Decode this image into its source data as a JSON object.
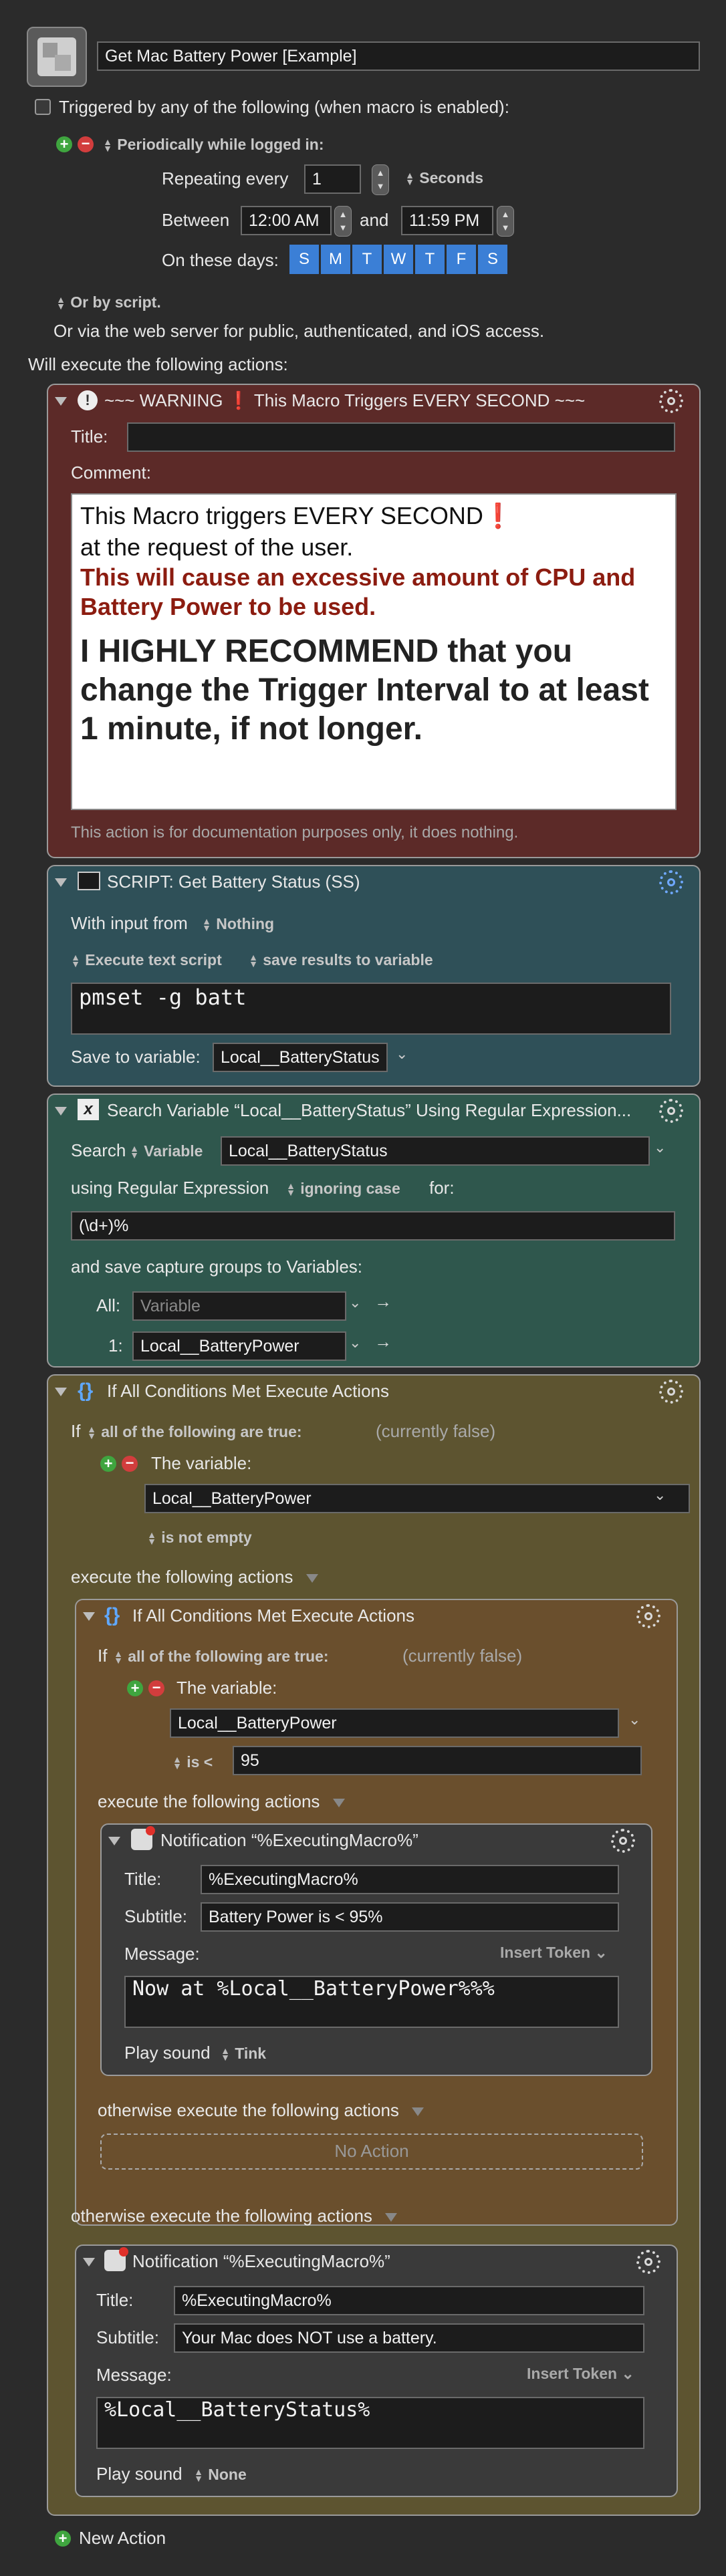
{
  "macro": {
    "name": "Get Mac Battery Power [Example]",
    "triggered_label": "Triggered by any of the following (when macro is enabled):",
    "trigger_type": "Periodically while logged in:",
    "repeating_label": "Repeating every",
    "repeating_value": "1",
    "repeating_unit": "Seconds",
    "between_label": "Between",
    "start_time": "12:00 AM",
    "and_label": "and",
    "end_time": "11:59 PM",
    "days_label": "On these days:",
    "days": [
      "S",
      "M",
      "T",
      "W",
      "T",
      "F",
      "S"
    ],
    "or_by_script": "Or by script.",
    "web_server": "Or via the web server for public, authenticated, and iOS access.",
    "will_execute": "Will execute the following actions:",
    "new_action": "New Action"
  },
  "warning": {
    "title": "~~~ WARNING",
    "title_tail": "This Macro Triggers EVERY SECOND ~~~",
    "title_label": "Title:",
    "title_value": "",
    "comment_label": "Comment:",
    "line1": "This Macro triggers EVERY SECOND",
    "line2": "at the request of the user.",
    "line3": "This will cause an excessive amount of CPU and Battery Power to be used.",
    "line4": "I HIGHLY RECOMMEND that you change the Trigger Interval to at least 1 minute, if not longer.",
    "footer": "This action is for documentation purposes only, it does nothing."
  },
  "script": {
    "title": "SCRIPT: Get Battery Status (SS)",
    "with_input": "With input from",
    "input_value": "Nothing",
    "execute_text": "Execute text script",
    "save_results": "save results to variable",
    "code": "pmset -g batt",
    "save_label": "Save to variable:",
    "save_value": "Local__BatteryStatus"
  },
  "regex": {
    "title": "Search Variable “Local__BatteryStatus” Using Regular Expression...",
    "search_label": "Search",
    "search_type": "Variable",
    "search_value": "Local__BatteryStatus",
    "using_label": "using Regular Expression",
    "case_label": "ignoring case",
    "for_label": "for:",
    "pattern": "(\\d+)%",
    "save_groups": "and save capture groups to Variables:",
    "all_label": "All:",
    "all_placeholder": "Variable",
    "one_label": "1:",
    "one_value": "Local__BatteryPower"
  },
  "if1": {
    "title": "If All Conditions Met Execute Actions",
    "if_label": "If",
    "all_following": "all of the following are true:",
    "currently": "(currently false)",
    "the_variable": "The variable:",
    "variable": "Local__BatteryPower",
    "condition": "is not empty",
    "execute_label": "execute the following actions",
    "otherwise_label": "otherwise execute the following actions"
  },
  "if2": {
    "title": "If All Conditions Met Execute Actions",
    "if_label": "If",
    "all_following": "all of the following are true:",
    "currently": "(currently false)",
    "the_variable": "The variable:",
    "variable": "Local__BatteryPower",
    "condition": "is <",
    "value": "95",
    "execute_label": "execute the following actions",
    "otherwise_label": "otherwise execute the following actions",
    "no_action": "No Action"
  },
  "notif1": {
    "title": "Notification “%ExecutingMacro%”",
    "title_label": "Title:",
    "title_value": "%ExecutingMacro%",
    "subtitle_label": "Subtitle:",
    "subtitle_value": "Battery Power is < 95%",
    "message_label": "Message:",
    "insert_token": "Insert Token",
    "message_value": "Now at %Local__BatteryPower%%%",
    "play_sound": "Play sound",
    "sound": "Tink"
  },
  "notif2": {
    "title": "Notification “%ExecutingMacro%”",
    "title_label": "Title:",
    "title_value": "%ExecutingMacro%",
    "subtitle_label": "Subtitle:",
    "subtitle_value": "Your Mac does NOT use a battery.",
    "message_label": "Message:",
    "insert_token": "Insert Token",
    "message_value": "%Local__BatteryStatus%",
    "play_sound": "Play sound",
    "sound": "None"
  },
  "colors": {
    "warning_bg": "#5c2a28",
    "script_bg": "#2f5058",
    "regex_bg": "#2f574d",
    "if_bg": "#5d5430",
    "if2_bg": "#6a4f2d",
    "notif_bg": "#3a3a3a",
    "day_blue": "#3b7fd6"
  }
}
